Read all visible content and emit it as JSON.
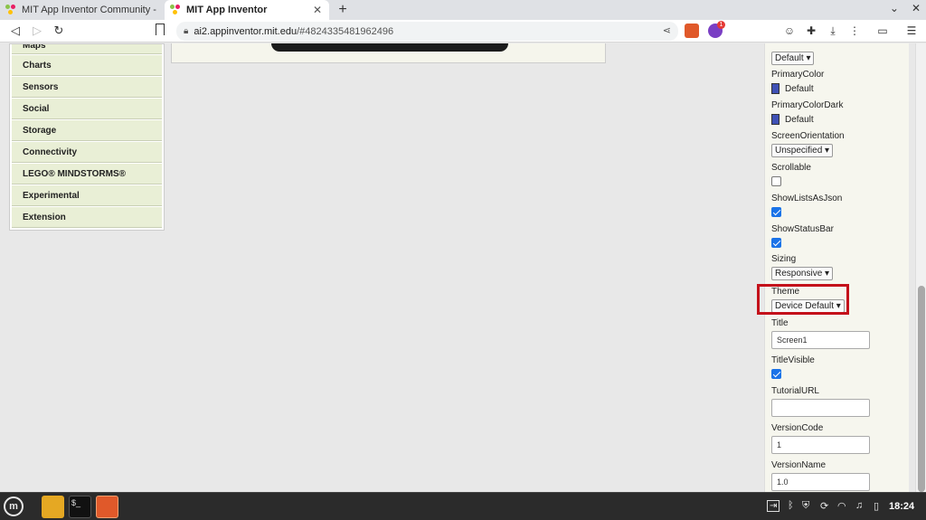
{
  "browser": {
    "tabs": [
      {
        "title": "MIT App Inventor Community - The",
        "active": false
      },
      {
        "title": "MIT App Inventor",
        "active": true
      }
    ],
    "new_tab_symbol": "+",
    "window_controls": {
      "minimize": "⌄",
      "close": "✕"
    },
    "address": {
      "host": "ai2.appinventor.mit.edu",
      "path": "/#4824335481962496"
    },
    "brave_badge": "1"
  },
  "palette": {
    "items": [
      {
        "label": "Maps"
      },
      {
        "label": "Charts"
      },
      {
        "label": "Sensors"
      },
      {
        "label": "Social"
      },
      {
        "label": "Storage"
      },
      {
        "label": "Connectivity"
      },
      {
        "label": "LEGO® MINDSTORMS®"
      },
      {
        "label": "Experimental"
      },
      {
        "label": "Extension"
      }
    ]
  },
  "properties": {
    "top_select": {
      "value": "Default ▾"
    },
    "primary_color": {
      "label": "PrimaryColor",
      "value": "Default",
      "color": "#3f51b5"
    },
    "primary_color_dark": {
      "label": "PrimaryColorDark",
      "value": "Default",
      "color": "#303f9f"
    },
    "screen_orientation": {
      "label": "ScreenOrientation",
      "value": "Unspecified ▾"
    },
    "scrollable": {
      "label": "Scrollable",
      "checked": false
    },
    "show_lists_as_json": {
      "label": "ShowListsAsJson",
      "checked": true
    },
    "show_status_bar": {
      "label": "ShowStatusBar",
      "checked": true
    },
    "sizing": {
      "label": "Sizing",
      "value": "Responsive ▾"
    },
    "theme": {
      "label": "Theme",
      "value": "Device Default ▾"
    },
    "title": {
      "label": "Title",
      "value": "Screen1"
    },
    "title_visible": {
      "label": "TitleVisible",
      "checked": true
    },
    "tutorial_url": {
      "label": "TutorialURL",
      "value": ""
    },
    "version_code": {
      "label": "VersionCode",
      "value": "1"
    },
    "version_name": {
      "label": "VersionName",
      "value": "1.0"
    }
  },
  "taskbar": {
    "clock": "18:24",
    "colors": {
      "files": "#e5a823",
      "terminal": "#111111",
      "brave": "#e0592a"
    }
  },
  "colors": {
    "highlight": "#c4111a",
    "palette_bg": "#e9efd6",
    "accent": "#1a73e8"
  }
}
